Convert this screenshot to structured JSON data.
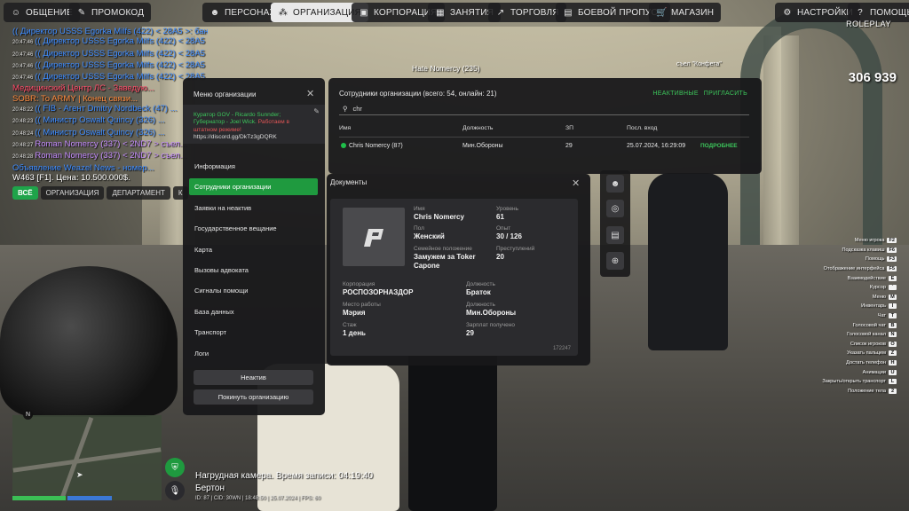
{
  "topbar": {
    "left": [
      {
        "label": "ОБЩЕНИЕ",
        "icon": "chat-icon"
      },
      {
        "label": "ПРОМОКОД",
        "icon": "ticket-icon"
      }
    ],
    "center": [
      {
        "label": "ПЕРСОНАЖ",
        "icon": "person-icon"
      },
      {
        "label": "ОРГАНИЗАЦИЯ",
        "icon": "group-icon",
        "active": true
      },
      {
        "label": "КОРПОРАЦИЯ",
        "icon": "briefcase-icon"
      },
      {
        "label": "ЗАНЯТИЯ",
        "icon": "calendar-icon"
      },
      {
        "label": "ТОРГОВЛЯ",
        "icon": "trade-icon"
      },
      {
        "label": "БОЕВОЙ ПРОПУСК",
        "icon": "pass-icon"
      },
      {
        "label": "МАГАЗИН",
        "icon": "cart-icon"
      }
    ],
    "right": [
      {
        "label": "НАСТРОЙКИ",
        "icon": "gear-icon"
      },
      {
        "label": "ПОМОЩЬ",
        "icon": "help-icon"
      }
    ]
  },
  "chat": {
    "lines": [
      {
        "ts": "",
        "text": "(( Директор USSS Egorka Milfs (422) < 28A5 >: банк инта ))",
        "color": "#3d8bff"
      },
      {
        "ts": "20:47:46",
        "text": "(( Директор USSS Egorka Milfs (422) < 28A5 >: банк инта ))",
        "color": "#3d8bff"
      },
      {
        "ts": "20:47:46",
        "text": "(( Директор USSS Egorka Milfs (422) < 28A5 >: банк инта ))",
        "color": "#3d8bff"
      },
      {
        "ts": "20:47:46",
        "text": "(( Директор USSS Egorka Milfs (422) < 28A5 >: банк инта ))",
        "color": "#3d8bff"
      },
      {
        "ts": "20:47:46",
        "text": "(( Директор USSS Egorka Milfs (422) < 28A5 >: банк инта ))",
        "color": "#3d8bff"
      },
      {
        "ts": "",
        "text": "Медицинский Центр ЛС - Заведую...",
        "color": "#ff4d6a"
      },
      {
        "ts": "",
        "text": "SOBR: To ARMY | Конец связи...",
        "color": "#ff8a3d"
      },
      {
        "ts": "20:48:22",
        "text": "(( FIB - Агент Dmitry Nordbeck (47) ...",
        "color": "#3d8bff"
      },
      {
        "ts": "20:48:23",
        "text": "(( Министр Oswalt Quincy (326) ...",
        "color": "#3d8bff"
      },
      {
        "ts": "20:48:24",
        "text": "(( Министр Oswalt Quincy (326) ...",
        "color": "#3d8bff"
      },
      {
        "ts": "20:48:27",
        "text": "Roman Nomercy (337) < 2ND7 > съел...",
        "color": "#c58cff"
      },
      {
        "ts": "20:48:28",
        "text": "Roman Nomercy (337) < 2ND7 > съел...",
        "color": "#c58cff"
      },
      {
        "ts": "",
        "text": "Объявление Weazel News - номер...",
        "color": "#3d8bff"
      },
      {
        "ts": "",
        "text": "W463 [F1]. Цена: 10.500.000$.",
        "color": "#ffffff"
      }
    ],
    "tabs": [
      "ВСЁ",
      "ОРГАНИЗАЦИЯ",
      "ДЕПАРТАМЕНТ",
      "К"
    ]
  },
  "org_menu": {
    "title": "Меню организации",
    "curator_line1": "Куратор GOV - Ricardo Sunnder;",
    "curator_line2_a": "Губернатор - Joel Wick.",
    "curator_line2_b": "Работаем в",
    "curator_line3": "штатном режиме!",
    "curator_link": "https://discord.gg/DkTz3gDQRK",
    "items": [
      "Информация",
      "Сотрудники организации",
      "Заявки на неактив",
      "Государственное вещание",
      "Карта",
      "Вызовы адвоката",
      "Сигналы помощи",
      "База данных",
      "Транспорт",
      "Логи"
    ],
    "active_index": 1,
    "btn_inactive": "Неактив",
    "btn_leave": "Покинуть организацию"
  },
  "employees": {
    "title": "Сотрудники организации (всего: 54, онлайн: 21)",
    "link_inactive": "НЕАКТИВНЫЕ",
    "link_invite": "ПРИГЛАСИТЬ",
    "search_value": "chr",
    "columns": [
      "Имя",
      "Должность",
      "ЗП",
      "Посл. вход"
    ],
    "rows": [
      {
        "name": "Chris Nomercy (87)",
        "position": "Мин.Обороны",
        "salary": "29",
        "last_login": "25.07.2024, 16:29:09",
        "action": "ПОДРОБНЕЕ"
      }
    ]
  },
  "documents": {
    "title": "Документы",
    "fields": {
      "name_label": "Имя",
      "name": "Chris Nomercy",
      "level_label": "Уровень",
      "level": "61",
      "sex_label": "Пол",
      "sex": "Женский",
      "exp_label": "Опыт",
      "exp": "30 / 126",
      "family_label": "Семейное положение",
      "family_a": "Замужем за Toker",
      "family_b": "Capone",
      "crimes_label": "Преступлений",
      "crimes": "20",
      "corp_label": "Корпорация",
      "corp": "РОСПОЗОРНАЗДОР",
      "corp_pos_label": "Должность",
      "corp_pos": "Браток",
      "work_label": "Место работы",
      "work": "Мэрия",
      "work_pos_label": "Должность",
      "work_pos": "Мин.Обороны",
      "tenure_label": "Стаж",
      "tenure": "1 день",
      "salary_label": "Зарплат получено",
      "salary": "29"
    },
    "id": "172247"
  },
  "hud": {
    "money": "306 939",
    "logo": "ROLEPLAY",
    "nametag_player": "Hate Nomercy (235)",
    "nametag_other": "съел \"Конфета\""
  },
  "hotkeys": [
    {
      "label": "Меню игрока",
      "key": "F2"
    },
    {
      "label": "Подсказка клавиш",
      "key": "F6"
    },
    {
      "label": "Помощь",
      "key": "F3"
    },
    {
      "label": "Отображение интерфейса",
      "key": "F5"
    },
    {
      "label": "Взаимодействие",
      "key": "E"
    },
    {
      "label": "Курсор",
      "key": "`"
    },
    {
      "label": "Меню",
      "key": "M"
    },
    {
      "label": "Инвентарь",
      "key": "I"
    },
    {
      "label": "Чат",
      "key": "T"
    },
    {
      "label": "Голосовой чат",
      "key": "B"
    },
    {
      "label": "Голосовой канал",
      "key": "N"
    },
    {
      "label": "Список игроков",
      "key": "O"
    },
    {
      "label": "Указать пальцем",
      "key": "Z"
    },
    {
      "label": "Достать телефон",
      "key": "H"
    },
    {
      "label": "Анимации",
      "key": "U"
    },
    {
      "label": "Закрыть/открыть транспорт",
      "key": "L"
    },
    {
      "label": "Положение тела",
      "key": "2"
    }
  ],
  "bodycam": {
    "title": "Нагрудная камера. Время записи: 04:19:40",
    "location": "Бертон",
    "info": "ID: 87 | CID: 30WN | 18:48:50 | 25.07.2024 | FPS: 60"
  },
  "minimap": {
    "north": "N"
  },
  "colors": {
    "accent": "#1f9a3f",
    "link": "#3cc65b",
    "panel": "#18181a"
  }
}
